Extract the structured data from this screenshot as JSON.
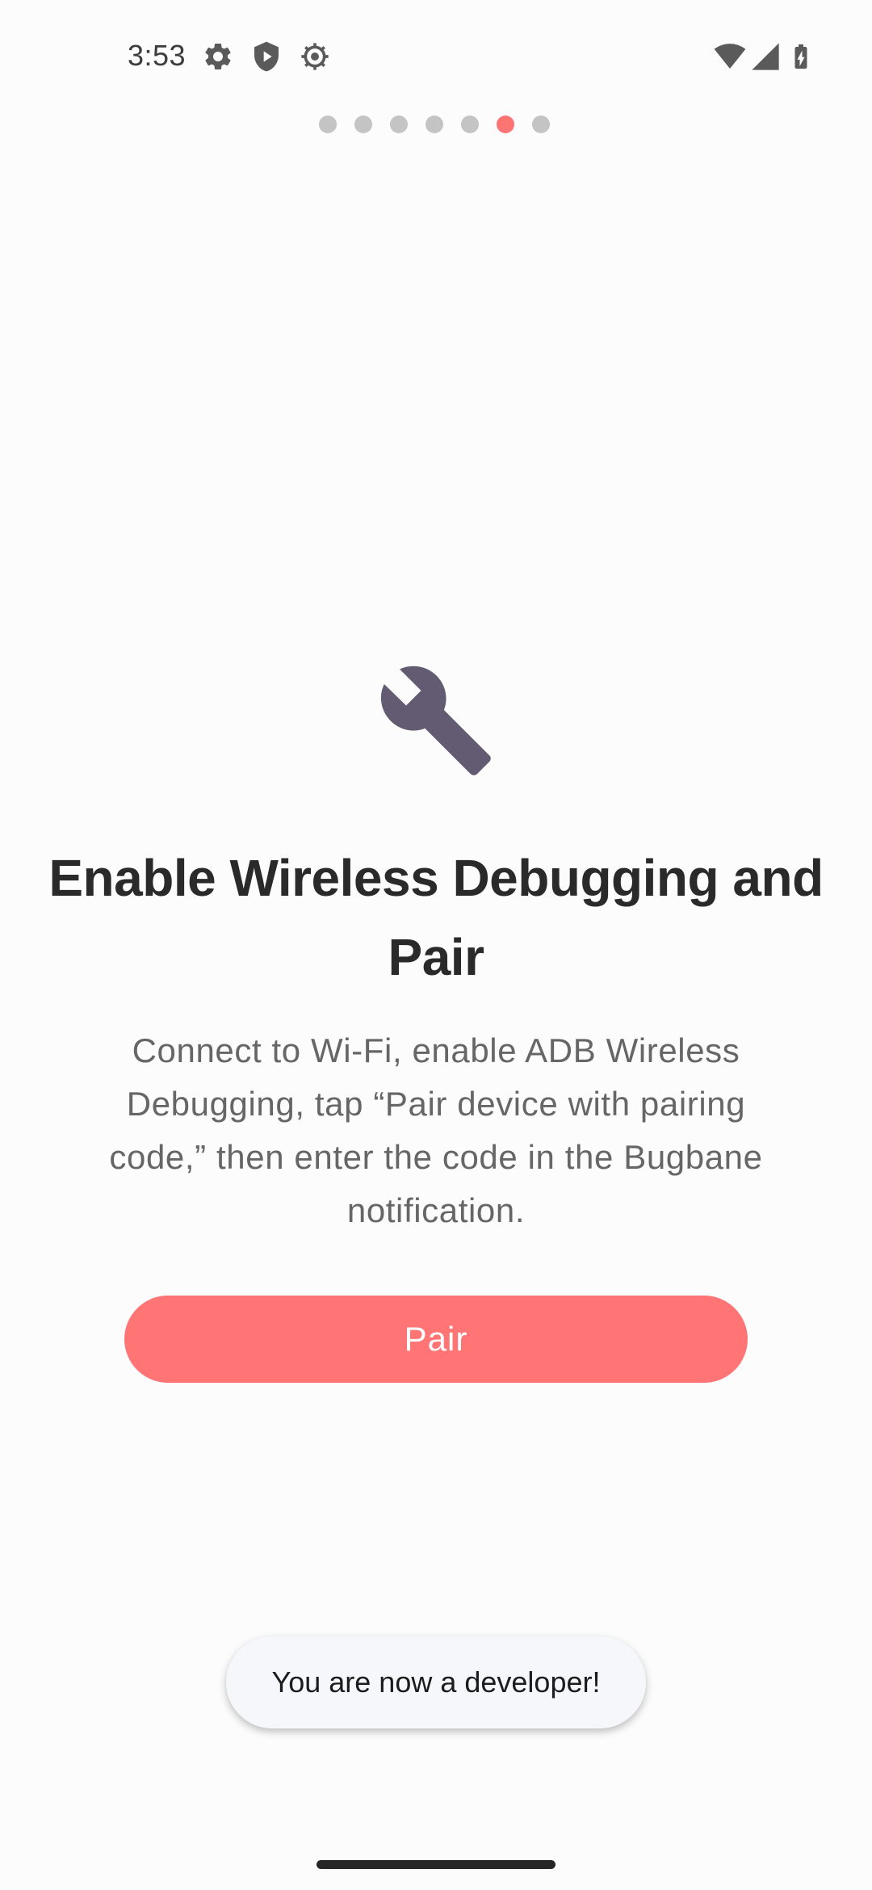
{
  "status_bar": {
    "time": "3:53",
    "left_icons": [
      "gear-icon",
      "shield-play-icon",
      "bug-gear-icon"
    ],
    "right_icons": [
      "wifi-icon",
      "signal-icon",
      "battery-charging-icon"
    ]
  },
  "pager": {
    "total": 7,
    "active_index": 5,
    "active_color": "#fc7474",
    "inactive_color": "#c4c4c4"
  },
  "content": {
    "icon": "wrench-icon",
    "icon_color": "#625b71",
    "title": "Enable Wireless Debugging and Pair",
    "body": "Connect to Wi-Fi, enable ADB Wireless Debugging, tap “Pair device with pairing code,” then enter the code in the Bugbane notification.",
    "button_label": "Pair",
    "accent_color": "#ff7575"
  },
  "toast": {
    "text": "You are now a developer!"
  }
}
